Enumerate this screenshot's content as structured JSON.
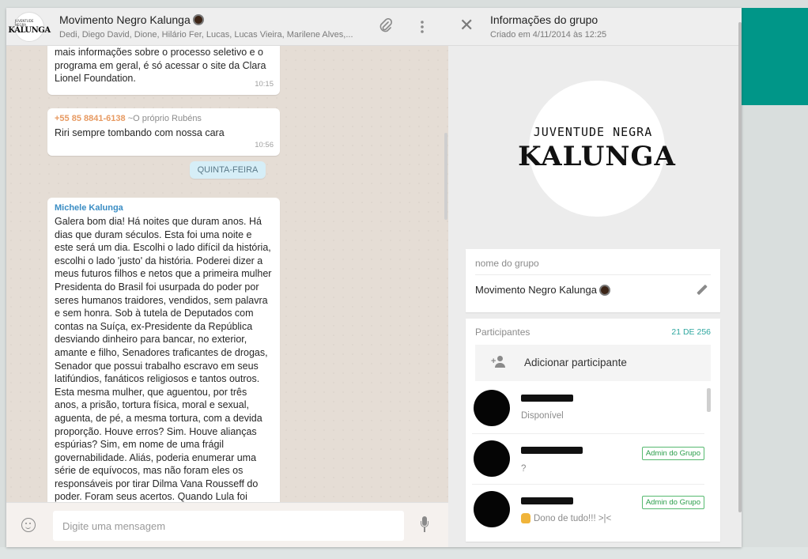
{
  "colors": {
    "accent": "#009688",
    "chat_bg": "#e5ddd5",
    "phone": "#e79a62",
    "sender": "#3a8dc4",
    "admin_badge": "#2a9d4a"
  },
  "chat": {
    "avatar_small_text": "JUVENTUDE NEGRA",
    "avatar_text": "KALUNGA",
    "title": "Movimento Negro Kalunga",
    "members_line": "Dedi, Diego David, Dione, Hilário Fer, Lucas, Lucas Vieira, Marilene Alves,...",
    "icons": {
      "attach": "paperclip-icon",
      "menu": "kebab-menu-icon",
      "emoji": "smiley-icon",
      "mic": "microphone-icon"
    }
  },
  "messages": [
    {
      "text": "mais informações sobre o processo seletivo e o programa em geral, é só acessar o site da Clara Lionel Foundation.",
      "time": "10:15"
    },
    {
      "phone": "+55 85 8841-6138",
      "alias": "~O próprio Rubéns",
      "text": "Riri sempre tombando com nossa cara",
      "time": "10:56"
    }
  ],
  "day_chip": "QUINTA-FEIRA",
  "long_message": {
    "sender": "Michele Kalunga",
    "text": "Galera bom dia! Há noites que duram anos. Há dias que duram séculos. Esta foi uma noite e este será um dia. Escolhi o lado difícil da história, escolhi o lado 'justo' da história. Poderei dizer a meus futuros filhos e netos que a primeira mulher Presidenta do Brasil foi usurpada do poder por seres humanos traidores, vendidos, sem palavra e sem honra. Sob à tutela de Deputados com contas na Suíça, ex-Presidente da República desviando dinheiro para bancar, no exterior, amante e filho, Senadores traficantes de drogas, Senador que possui trabalho escravo em seus latifúndios, fanáticos religiosos e tantos outros. Esta mesma mulher, que aguentou, por três anos, a prisão, tortura física, moral e sexual, aguenta, de pé, a mesma tortura, com a devida proporção. Houve erros? Sim. Houve alianças espúrias? Sim, em nome de uma frágil governabilidade. Aliás, poderia enumerar uma série de equívocos, mas não foram eles os responsáveis por tirar Dilma Vana Rousseff do poder. Foram seus acertos. Quando Lula foi"
  },
  "compose": {
    "placeholder": "Digite uma mensagem"
  },
  "info": {
    "title": "Informações do grupo",
    "created": "Criado em 4/11/2014 às 12:25",
    "logo_small": "JUVENTUDE NEGRA",
    "logo_big": "KALUNGA",
    "name_label": "nome do grupo",
    "name_value": "Movimento Negro Kalunga",
    "participants_label": "Participantes",
    "participants_count": "21 DE 256",
    "add_participant": "Adicionar participante",
    "members": [
      {
        "status": "Disponível",
        "admin": ""
      },
      {
        "status": "?",
        "admin": "Admin do Grupo"
      },
      {
        "status": "Dono de tudo!!! >|<",
        "admin": "Admin do Grupo"
      }
    ]
  }
}
